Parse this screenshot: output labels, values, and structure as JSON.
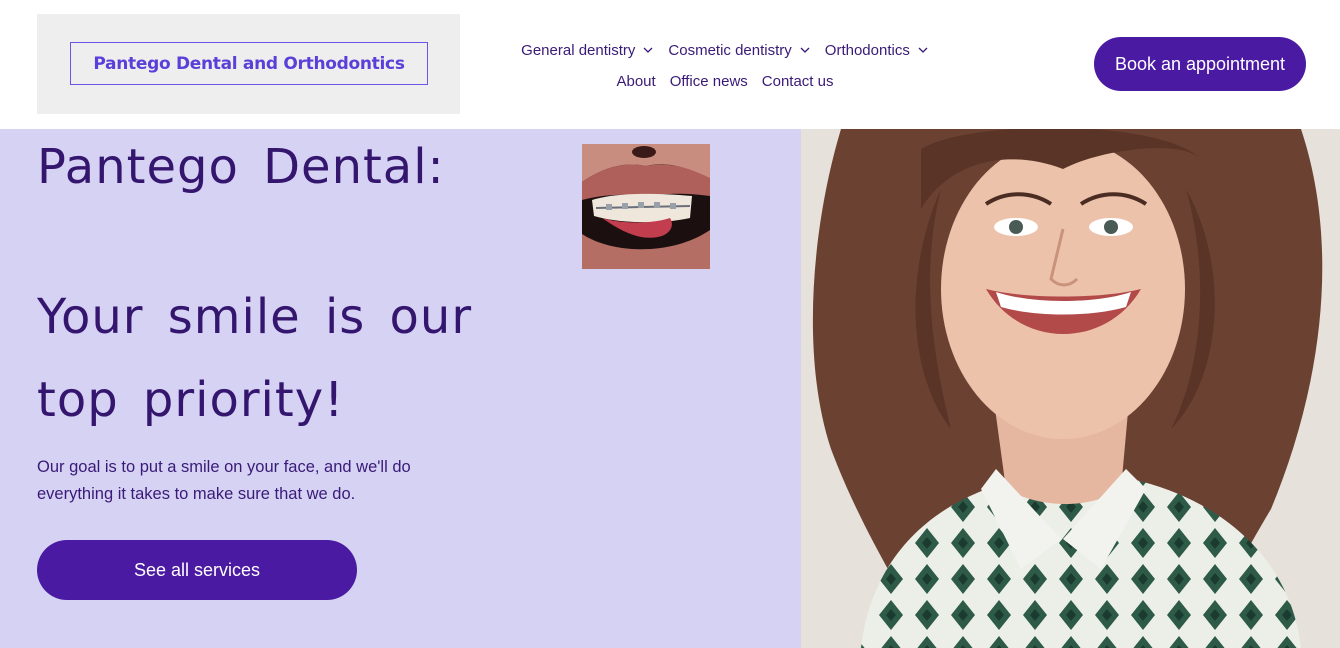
{
  "header": {
    "logo_text": "Pantego Dental and Orthodontics",
    "nav_row1": [
      {
        "label": "General dentistry",
        "has_dropdown": true
      },
      {
        "label": "Cosmetic dentistry",
        "has_dropdown": true
      },
      {
        "label": "Orthodontics",
        "has_dropdown": true
      }
    ],
    "nav_row2": [
      {
        "label": "About"
      },
      {
        "label": "Office news"
      },
      {
        "label": "Contact us"
      }
    ],
    "cta_label": "Book an appointment"
  },
  "hero": {
    "title_line1": "Pantego Dental:",
    "title_line2": "Your smile is our",
    "title_line3": "top priority!",
    "subtitle": "Our goal is to put a smile on your face, and we'll do everything it takes to make sure that we do.",
    "cta_label": "See all services"
  },
  "colors": {
    "brand": "#4b1aa3",
    "hero_bg": "#d5d2f3",
    "text": "#35166f",
    "logo_bg": "#eeeeee"
  },
  "icons": [
    "chevron-down-icon"
  ]
}
